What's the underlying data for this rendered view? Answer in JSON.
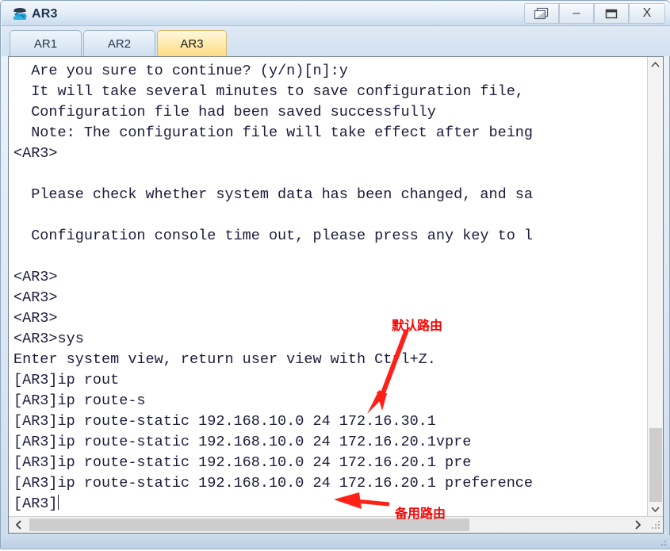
{
  "window": {
    "title": "AR3",
    "icon": "router-icon",
    "controls": [
      {
        "name": "cascade-windows-button",
        "glyph": "cascade"
      },
      {
        "name": "minimize-button",
        "glyph": "–"
      },
      {
        "name": "maximize-button",
        "glyph": "□"
      },
      {
        "name": "close-button",
        "glyph": "X"
      }
    ]
  },
  "tabs": [
    {
      "label": "AR1",
      "active": false
    },
    {
      "label": "AR2",
      "active": false
    },
    {
      "label": "AR3",
      "active": true
    }
  ],
  "terminal": {
    "lines": [
      "  Are you sure to continue? (y/n)[n]:y",
      "  It will take several minutes to save configuration file,",
      "  Configuration file had been saved successfully",
      "  Note: The configuration file will take effect after being",
      "<AR3>",
      "",
      "  Please check whether system data has been changed, and sa",
      "",
      "  Configuration console time out, please press any key to l",
      "",
      "<AR3>",
      "<AR3>",
      "<AR3>",
      "<AR3>sys",
      "Enter system view, return user view with Ctrl+Z.",
      "[AR3]ip rout",
      "[AR3]ip route-s",
      "[AR3]ip route-static 192.168.10.0 24 172.16.30.1",
      "[AR3]ip route-static 192.168.10.0 24 172.16.20.1vpre",
      "[AR3]ip route-static 192.168.10.0 24 172.16.20.1 pre",
      "[AR3]ip route-static 192.168.10.0 24 172.16.20.1 preference"
    ],
    "prompt_line": "[AR3]"
  },
  "annotations": {
    "default_route": {
      "label": "默认路由",
      "color": "#ff0000",
      "arrow": "down-left-arrow"
    },
    "backup_route": {
      "label": "备用路由",
      "color": "#ff0000",
      "arrow": "left-arrow"
    }
  },
  "scrollbars": {
    "vertical": {
      "up_glyph": "˄",
      "down_glyph": "˅"
    },
    "horizontal": {
      "left_glyph": "‹",
      "right_glyph": "›"
    }
  }
}
